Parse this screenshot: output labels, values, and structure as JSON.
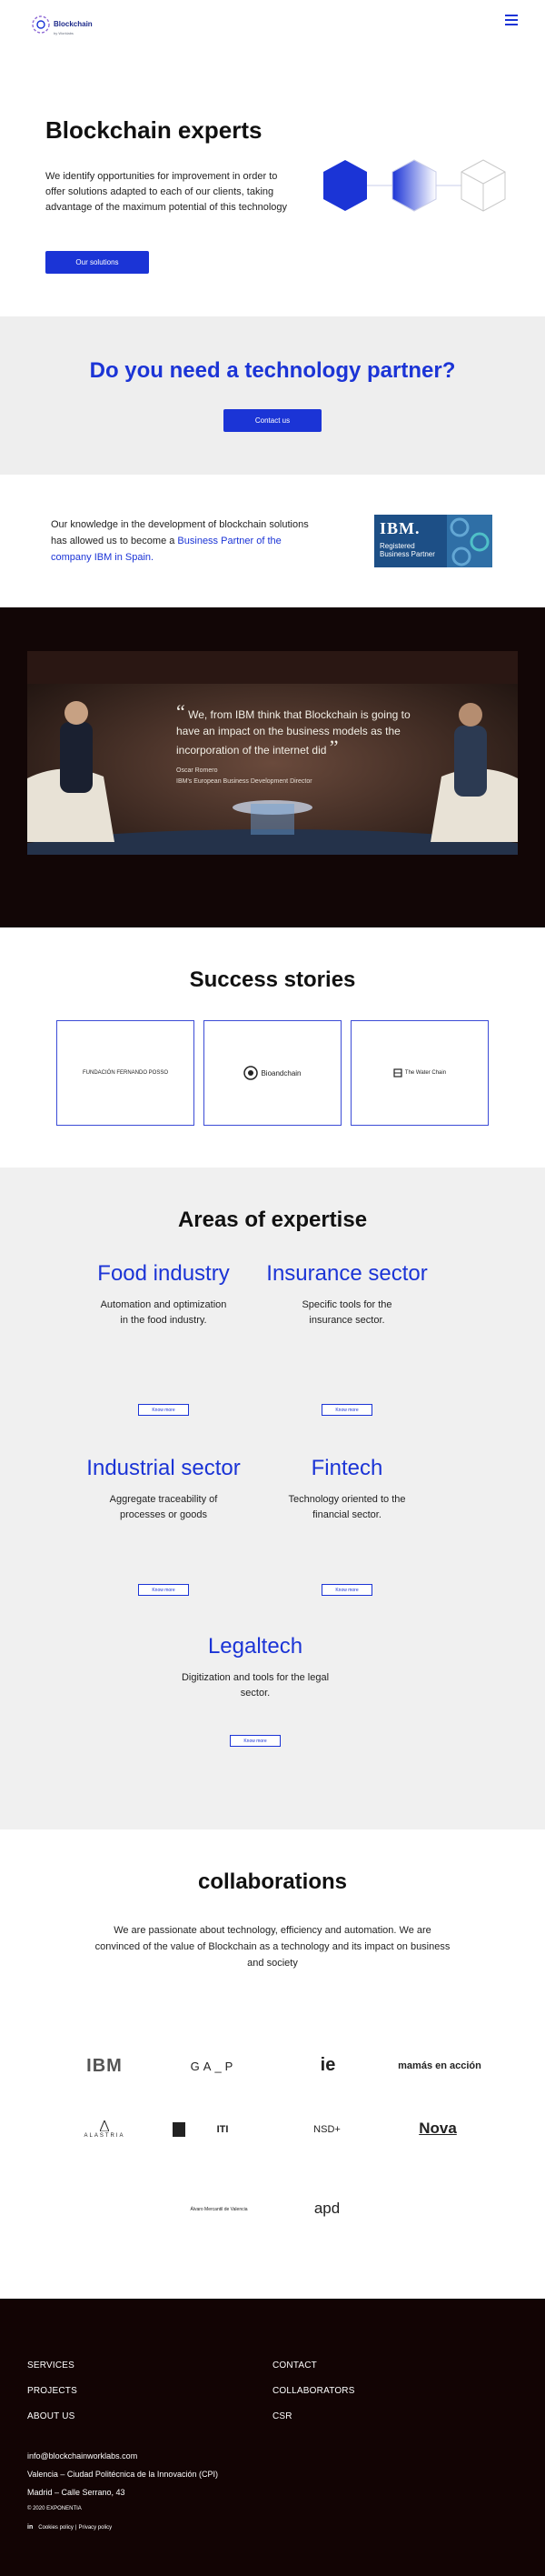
{
  "header": {
    "logo_text": "Blockchain",
    "logo_sub": "by Worklabs"
  },
  "hero": {
    "title": "Blockchain experts",
    "text": "We identify opportunities for improvement in order to offer solutions adapted to each of our clients, taking advantage of the maximum potential of this technology",
    "button": "Our solutions"
  },
  "partner": {
    "title": "Do you need a technology partner?",
    "button": "Contact us"
  },
  "ibm": {
    "text_before": "Our knowledge in the development of blockchain solutions has allowed us to become a ",
    "link": "Business Partner of the company IBM in Spain.",
    "badge_logo": "IBM.",
    "badge_line1": "Registered",
    "badge_line2": "Business Partner"
  },
  "video": {
    "quote_open": "“",
    "quote": "We, from IBM think that Blockchain is going to have an impact on the business models as the incorporation of the internet did",
    "quote_close": "”",
    "author": "Oscar Romero",
    "role": "IBM's European Business Development Director"
  },
  "stories": {
    "title": "Success stories",
    "cards": [
      {
        "label": "FUNDACIÓN FERNANDO POSSO"
      },
      {
        "label": "Bioandchain"
      },
      {
        "label": "The Water Chain"
      }
    ]
  },
  "areas": {
    "title": "Areas of expertise",
    "button_label": "Know more",
    "items": [
      {
        "title": "Food industry",
        "desc": "Automation and optimization in the food industry."
      },
      {
        "title": "Insurance sector",
        "desc": "Specific tools for the insurance sector."
      },
      {
        "title": "Industrial sector",
        "desc": "Aggregate traceability of processes or goods"
      },
      {
        "title": "Fintech",
        "desc": "Technology oriented to the financial sector."
      },
      {
        "title": "Legaltech",
        "desc": "Digitization and tools for the legal sector."
      }
    ]
  },
  "collab": {
    "title": "collaborations",
    "text": "We are passionate about technology, efficiency and automation. We are convinced of the value of Blockchain as a technology and its impact on business and society",
    "logos": [
      "IBM",
      "GA_P",
      "ie",
      "mamás en acción",
      "ALASTRIA",
      "ITI",
      "NSD+",
      "Nova",
      "Álvaro Mercantil de Valencia",
      "apd"
    ]
  },
  "footer": {
    "links_left": [
      "SERVICES",
      "PROJECTS",
      "ABOUT US"
    ],
    "links_right": [
      "CONTACT",
      "COLLABORATORS",
      "CSR"
    ],
    "email": "info@blockchainworklabs.com",
    "address1": "Valencia – Ciudad Politécnica de la Innovación (CPI)",
    "address2": "Madrid – Calle Serrano, 43",
    "copyright": "© 2020 EXPONENTIA",
    "linkedin": "in",
    "cookies": "Cookies policy",
    "privacy": "Privacy policy"
  },
  "colors": {
    "accent": "#1b34d6",
    "dark_bg": "#120404",
    "gray_bg": "#eeeeee"
  }
}
